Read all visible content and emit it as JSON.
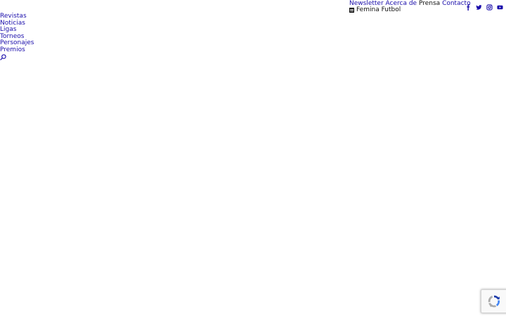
{
  "top_links": {
    "newsletter": "Newsletter",
    "about": "Acerca de",
    "press": "Prensa",
    "contact": "Contacto"
  },
  "brand": {
    "name": "Femina Futbol",
    "icon": "document-icon"
  },
  "social": {
    "facebook": "facebook-icon",
    "twitter": "twitter-icon",
    "instagram": "instagram-icon",
    "youtube": "youtube-icon",
    "color": "#1a0dab"
  },
  "nav": {
    "items": [
      {
        "label": "Revistas"
      },
      {
        "label": "Noticias"
      },
      {
        "label": "Ligas"
      },
      {
        "label": "Torneos"
      },
      {
        "label": "Personajes"
      },
      {
        "label": "Premios"
      }
    ],
    "search_icon": "search-icon"
  },
  "recaptcha": {
    "icon": "recaptcha-icon"
  },
  "colors": {
    "link": "#1a0dab",
    "text": "#222222",
    "background": "#ffffff"
  }
}
